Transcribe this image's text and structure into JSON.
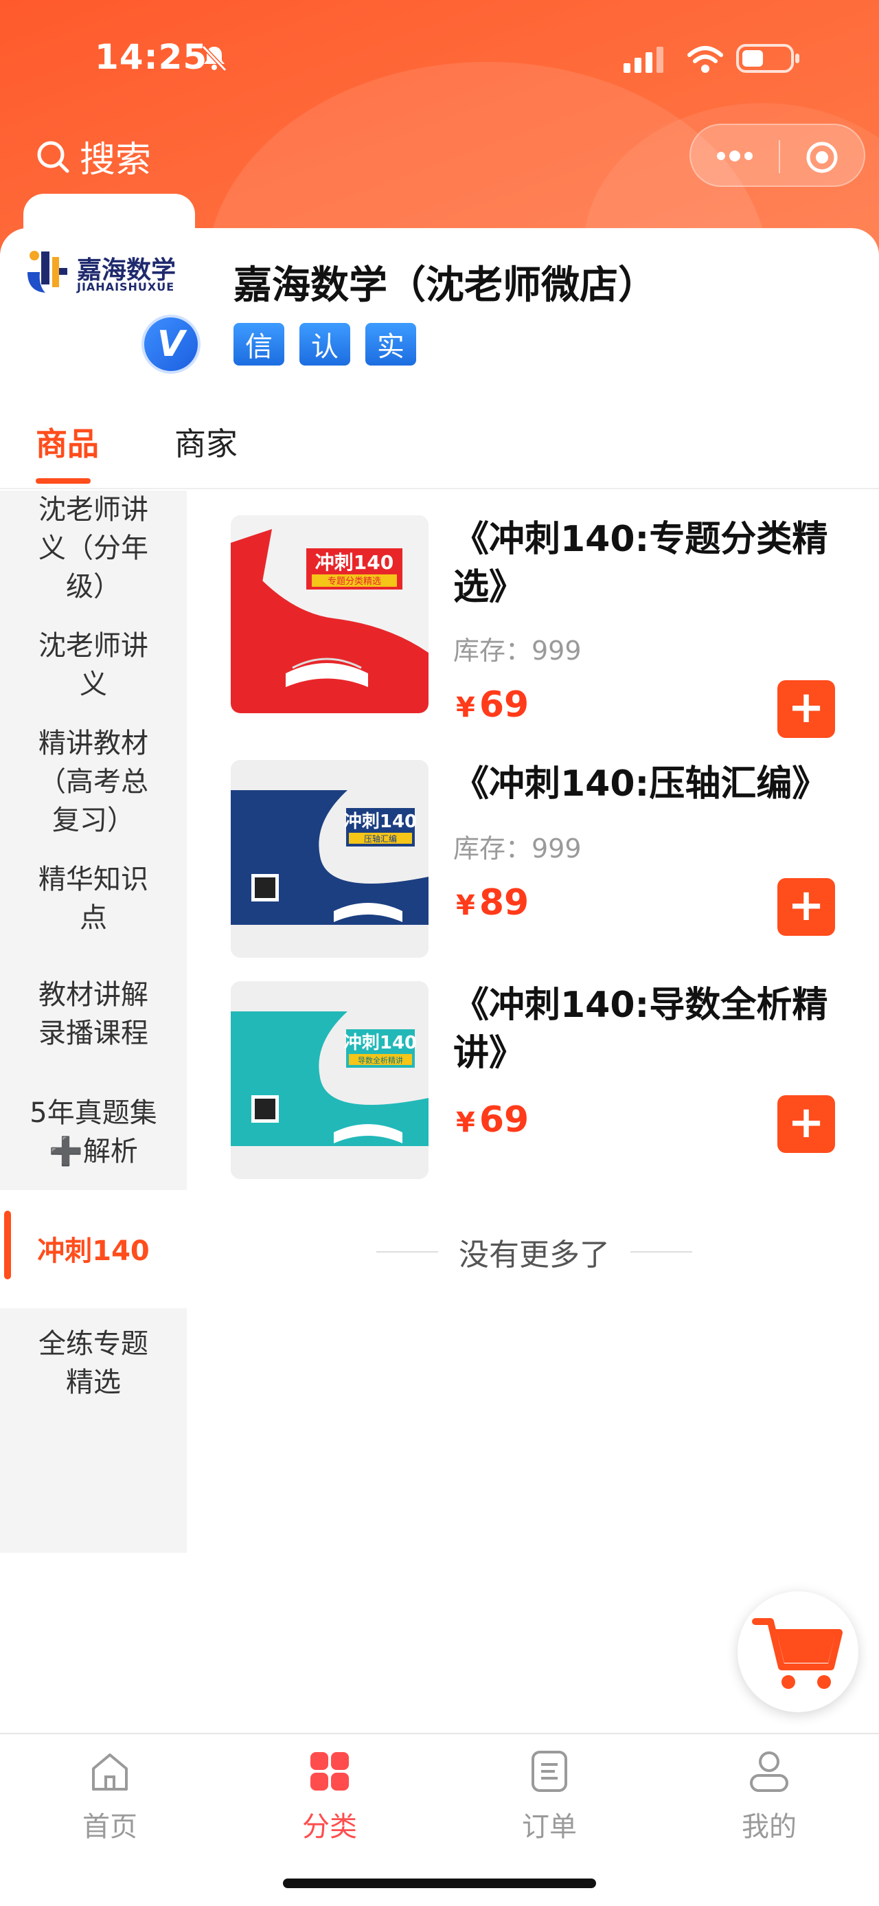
{
  "status_bar": {
    "time": "14:25"
  },
  "search": {
    "label": "搜索"
  },
  "shop": {
    "logo_text": "嘉海数学",
    "logo_sub": "JIAHAISHUXUE",
    "verified_mark": "V",
    "name": "嘉海数学（沈老师微店）",
    "badges": [
      "信",
      "认",
      "实"
    ]
  },
  "tabs": [
    {
      "label": "商品",
      "active": true
    },
    {
      "label": "商家",
      "active": false
    }
  ],
  "sidebar": {
    "items": [
      {
        "label": "沈老师讲\n义（分年\n级）"
      },
      {
        "label": "沈老师讲\n义"
      },
      {
        "label": "精讲教材\n（高考总\n复习）"
      },
      {
        "label": "精华知识\n点"
      },
      {
        "label": "教材讲解\n录播课程"
      },
      {
        "label": "5年真题集\n➕解析"
      },
      {
        "label": "冲刺140",
        "active": true
      },
      {
        "label": "全练专题\n精选"
      }
    ]
  },
  "products": [
    {
      "title": "《冲刺140:专题分类精选》",
      "stock": "库存：999",
      "price": "69",
      "currency": "¥",
      "cover_color": "#e8262a",
      "cover_title": "冲刺140",
      "cover_sub": "专题分类精选"
    },
    {
      "title": "《冲刺140:压轴汇编》",
      "stock": "库存：999",
      "price": "89",
      "currency": "¥",
      "cover_color": "#1c3f82",
      "cover_title": "冲刺140",
      "cover_sub": "压轴汇编"
    },
    {
      "title": "《冲刺140:导数全析精讲》",
      "stock": "",
      "price": "69",
      "currency": "¥",
      "cover_color": "#22b8b8",
      "cover_title": "冲刺140",
      "cover_sub": "导数全析精讲"
    }
  ],
  "add_button_label": "+",
  "list_end": "没有更多了",
  "bottom_nav": [
    {
      "label": "首页",
      "icon": "home-icon",
      "active": false
    },
    {
      "label": "分类",
      "icon": "category-icon",
      "active": true
    },
    {
      "label": "订单",
      "icon": "order-icon",
      "active": false
    },
    {
      "label": "我的",
      "icon": "profile-icon",
      "active": false
    }
  ],
  "colors": {
    "accent": "#ff4d1c",
    "price": "#ff3b1a",
    "header": "#ff5a2c"
  }
}
